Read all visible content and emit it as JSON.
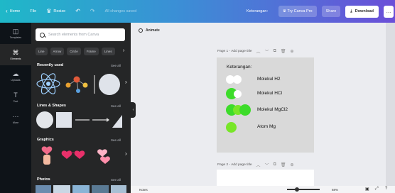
{
  "topbar": {
    "home": "Home",
    "file": "File",
    "resize": "Resize",
    "save_status": "All changes saved",
    "keterangan": "Keterangan:",
    "try_pro": "Try Canva Pro",
    "share": "Share",
    "download": "Download",
    "more": "…"
  },
  "rail": [
    {
      "label": "Templates",
      "icon": "templates-icon"
    },
    {
      "label": "Elements",
      "icon": "elements-icon"
    },
    {
      "label": "Uploads",
      "icon": "uploads-icon"
    },
    {
      "label": "Text",
      "icon": "text-icon"
    },
    {
      "label": "More",
      "icon": "more-icon"
    }
  ],
  "panel": {
    "search_placeholder": "Search elements from Canva",
    "chips": [
      "Line",
      "Arrow",
      "Circle",
      "Frame",
      "Lines"
    ],
    "sections": [
      {
        "title": "Recently used",
        "link": "See all"
      },
      {
        "title": "Lines & Shapes",
        "link": "See all"
      },
      {
        "title": "Graphics",
        "link": "See all"
      },
      {
        "title": "Photos",
        "link": "See all"
      }
    ]
  },
  "canvas": {
    "animate": "Animate",
    "page1_title": "Page 1 - Add page title",
    "page2_title": "Page 2 - Add page title",
    "legend_title": "Keterangan:",
    "legend": [
      {
        "label": "Molekul H2",
        "colors": [
          "#ffffff",
          "#ffffff"
        ]
      },
      {
        "label": "Molekul HCl",
        "colors": [
          "#3ddc2a",
          "#ffffff"
        ]
      },
      {
        "label": "Molekul MgCl2",
        "colors": [
          "#3ddc2a",
          "#78e628",
          "#3ddc2a"
        ]
      },
      {
        "label": "Atom Mg",
        "colors": [
          "#78e628"
        ]
      }
    ]
  },
  "bottombar": {
    "notes": "Notes",
    "zoom": "68%"
  },
  "colors": {
    "accent": "#3b8fd6",
    "panel_bg": "#252627",
    "rail_bg": "#0e1318",
    "page_bg": "#d9d9d9"
  }
}
